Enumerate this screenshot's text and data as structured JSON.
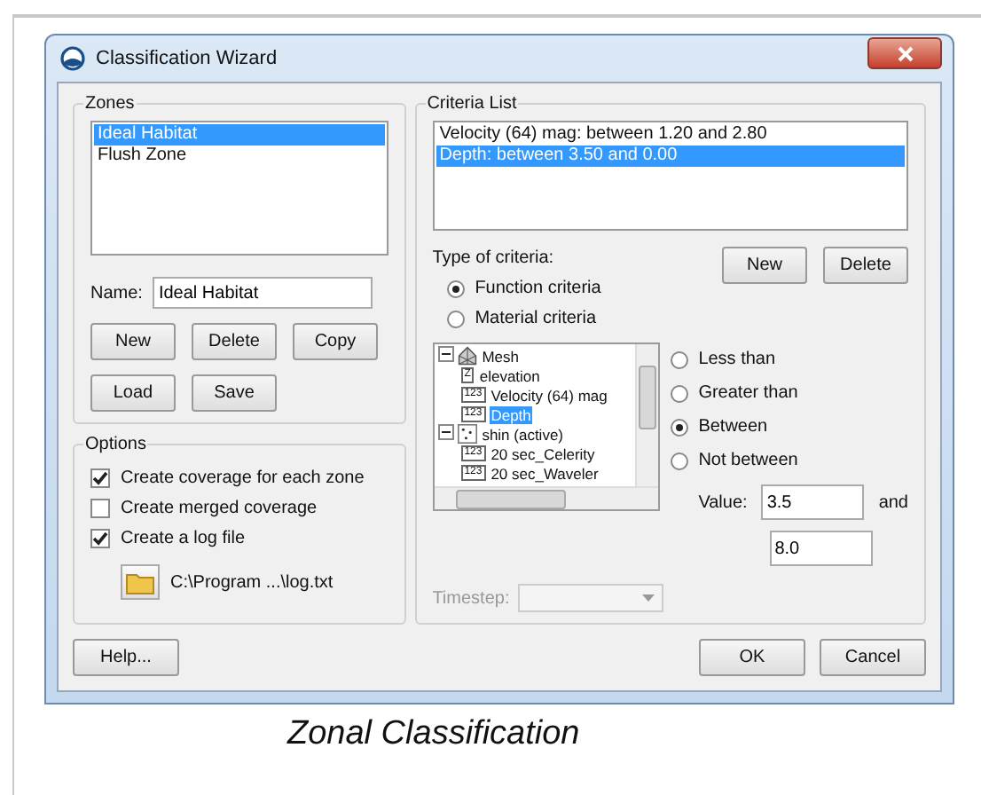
{
  "window": {
    "title": "Classification Wizard"
  },
  "zones": {
    "title": "Zones",
    "items": [
      {
        "label": "Ideal Habitat",
        "selected": true
      },
      {
        "label": "Flush Zone",
        "selected": false
      }
    ],
    "name_label": "Name:",
    "name_value": "Ideal Habitat",
    "buttons": [
      "New",
      "Delete",
      "Copy",
      "Load",
      "Save"
    ]
  },
  "options": {
    "title": "Options",
    "checks": [
      {
        "label": "Create coverage for each zone",
        "checked": true
      },
      {
        "label": "Create merged coverage",
        "checked": false
      },
      {
        "label": "Create a log file",
        "checked": true
      }
    ],
    "log_path": "C:\\Program ...\\log.txt"
  },
  "criteria": {
    "title": "Criteria List",
    "items": [
      {
        "label": "Velocity (64) mag: between 1.20 and 2.80",
        "selected": false
      },
      {
        "label": "Depth: between 3.50 and 0.00",
        "selected": true
      }
    ],
    "type_label": "Type of criteria:",
    "buttons": [
      "New",
      "Delete"
    ],
    "types": [
      {
        "label": "Function criteria",
        "selected": true
      },
      {
        "label": "Material criteria",
        "selected": false
      }
    ],
    "tree": [
      {
        "label": "Mesh",
        "kind": "mesh",
        "expanded": true,
        "selected": false,
        "children": [
          {
            "label": "elevation",
            "icon_text": "Z",
            "selected": false
          },
          {
            "label": "Velocity (64) mag",
            "icon_text": "123",
            "selected": false
          },
          {
            "label": "Depth",
            "icon_text": "123",
            "selected": true
          }
        ]
      },
      {
        "label": "shin (active)",
        "kind": "scatter",
        "expanded": true,
        "selected": false,
        "children": [
          {
            "label": "20 sec_Celerity",
            "icon_text": "123",
            "selected": false
          },
          {
            "label": "20 sec_Waveler",
            "icon_text": "123",
            "selected": false
          }
        ]
      }
    ],
    "comparisons": [
      {
        "label": "Less than",
        "selected": false
      },
      {
        "label": "Greater than",
        "selected": false
      },
      {
        "label": "Between",
        "selected": true
      },
      {
        "label": "Not between",
        "selected": false
      }
    ],
    "value_label": "Value:",
    "value": "3.5",
    "and_label": "and",
    "value2": "8.0",
    "timestep": {
      "label": "Timestep:",
      "disabled": true
    }
  },
  "footer_buttons": [
    "Help...",
    "OK",
    "Cancel"
  ],
  "caption": "Zonal Classification"
}
